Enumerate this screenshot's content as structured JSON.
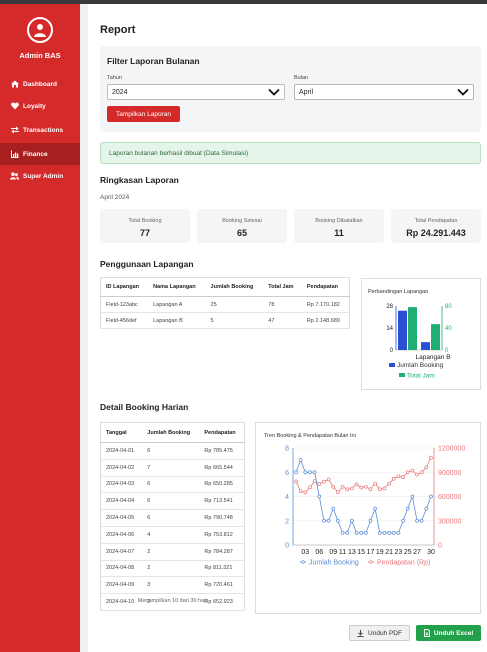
{
  "sidebar": {
    "brand": "Admin BAS",
    "items": [
      {
        "label": "Dashboard",
        "icon": "home-icon"
      },
      {
        "label": "Loyalty",
        "icon": "heart-icon"
      },
      {
        "label": "Transactions",
        "icon": "exchange-icon"
      },
      {
        "label": "Finance",
        "icon": "chart-icon",
        "active": true
      },
      {
        "label": "Super Admin",
        "icon": "users-icon"
      }
    ]
  },
  "page": {
    "title": "Report"
  },
  "filter": {
    "title": "Filter Laporan Bulanan",
    "year_label": "Tahun",
    "year_value": "2024",
    "month_label": "Bulan",
    "month_value": "April",
    "submit_label": "Tampilkan Laporan"
  },
  "alert": {
    "text": "Laporan bulanan berhasil dibuat (Data Simulasi)"
  },
  "summary": {
    "title": "Ringkasan Laporan",
    "period": "April 2024",
    "cards": [
      {
        "label": "Total Booking",
        "value": "77"
      },
      {
        "label": "Booking Selesai",
        "value": "65"
      },
      {
        "label": "Booking Dibatalkan",
        "value": "11"
      },
      {
        "label": "Total Pendapatan",
        "value": "Rp 24.291.443"
      }
    ]
  },
  "usage": {
    "title": "Penggunaan Lapangan",
    "headers": [
      "ID Lapangan",
      "Nama Lapangan",
      "Jumlah Booking",
      "Total Jam",
      "Pendapatan"
    ],
    "rows": [
      [
        "Field-123abc",
        "Lapangan A",
        "25",
        "78",
        "Rp 7.170.182"
      ],
      [
        "Field-456def",
        "Lapangan B",
        "5",
        "47",
        "Rp 2.148.689"
      ]
    ]
  },
  "daily": {
    "title": "Detail Booking Harian",
    "headers": [
      "Tanggal",
      "Jumlah Booking",
      "Pendapatan"
    ],
    "rows": [
      [
        "2024-04-01",
        "6",
        "Rp 785.475"
      ],
      [
        "2024-04-02",
        "7",
        "Rp 665.544"
      ],
      [
        "2024-04-03",
        "6",
        "Rp 650.285"
      ],
      [
        "2024-04-04",
        "6",
        "Rp 713.541"
      ],
      [
        "2024-04-05",
        "6",
        "Rp 790.748"
      ],
      [
        "2024-04-06",
        "4",
        "Rp 753.812"
      ],
      [
        "2024-04-07",
        "2",
        "Rp 784.287"
      ],
      [
        "2024-04-08",
        "2",
        "Rp 811.321"
      ],
      [
        "2024-04-09",
        "3",
        "Rp 720.461"
      ],
      [
        "2024-04-10",
        "2",
        "Rp 652.923"
      ]
    ],
    "footer": "Menampilkan 10 dari 30 hari"
  },
  "export": {
    "pdf_label": "Unduh PDF",
    "excel_label": "Unduh Excel"
  },
  "colors": {
    "sidebar": "#d42a2a",
    "blue": "#2a4fd4",
    "green": "#1fae73",
    "line_blue": "#5b8ed8",
    "line_red": "#e8787a"
  },
  "chart_data": [
    {
      "type": "bar",
      "title": "Perbandingan Lapangan",
      "categories": [
        "Lapangan A",
        "Lapangan B"
      ],
      "category_labels_shown": [
        "Lapangan B"
      ],
      "series": [
        {
          "name": "Jumlah Booking",
          "axis": "left",
          "values": [
            25,
            5
          ]
        },
        {
          "name": "Total Jam",
          "axis": "right",
          "values": [
            78,
            47
          ]
        }
      ],
      "y_left": {
        "ticks": [
          0,
          14,
          28
        ],
        "lim": [
          0,
          28
        ]
      },
      "y_right": {
        "ticks": [
          0,
          40,
          80
        ],
        "lim": [
          0,
          80
        ]
      },
      "legend": "bottom"
    },
    {
      "type": "line",
      "title": "Tren Booking & Pendapatan Bulan Ini",
      "x": [
        1,
        2,
        3,
        4,
        5,
        6,
        7,
        8,
        9,
        10,
        11,
        12,
        13,
        14,
        15,
        16,
        17,
        18,
        19,
        20,
        21,
        22,
        23,
        24,
        25,
        26,
        27,
        28,
        29,
        30
      ],
      "x_ticks": [
        "03",
        "06",
        "09",
        "11",
        "13",
        "15",
        "17",
        "19",
        "21",
        "23",
        "25",
        "27",
        "30"
      ],
      "series": [
        {
          "name": "Jumlah Booking",
          "axis": "left",
          "values": [
            6,
            7,
            6,
            6,
            6,
            4,
            2,
            2,
            3,
            2,
            1,
            1,
            2,
            1,
            1,
            1,
            2,
            3,
            1,
            1,
            1,
            1,
            1,
            2,
            3,
            4,
            2,
            2,
            3,
            4
          ]
        },
        {
          "name": "Pendapatan (Rp)",
          "axis": "right",
          "values": [
            785475,
            665544,
            650285,
            713541,
            790748,
            753812,
            784287,
            811321,
            720461,
            652923,
            720000,
            690000,
            700000,
            750000,
            710000,
            720000,
            690000,
            760000,
            690000,
            700000,
            760000,
            820000,
            850000,
            840000,
            900000,
            920000,
            870000,
            900000,
            960000,
            1080000
          ]
        }
      ],
      "y_left": {
        "ticks": [
          0,
          2,
          4,
          6,
          8
        ],
        "lim": [
          0,
          8
        ]
      },
      "y_right": {
        "ticks": [
          0,
          300000,
          600000,
          900000,
          1200000
        ],
        "lim": [
          0,
          1200000
        ]
      },
      "legend": "bottom"
    }
  ]
}
